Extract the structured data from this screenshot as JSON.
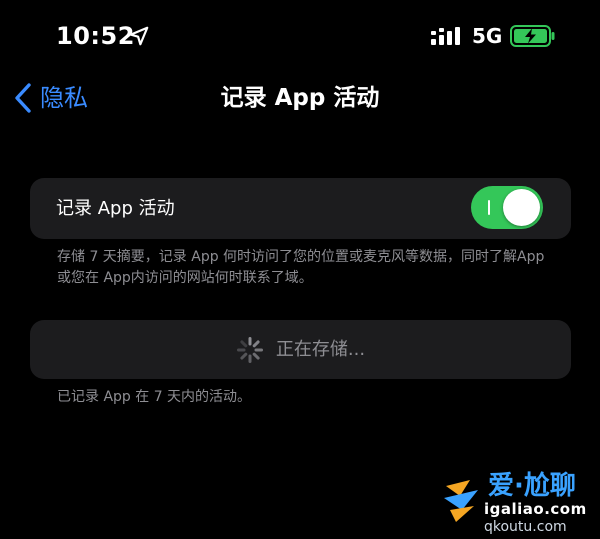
{
  "status_bar": {
    "time": "10:52",
    "network": "5G",
    "icons": [
      "location-arrow-icon",
      "cellular-signal-icon",
      "battery-charging-icon"
    ]
  },
  "nav": {
    "back_label": "隐私",
    "title": "记录 App 活动"
  },
  "toggle_group": {
    "label": "记录 App 活动",
    "enabled": true
  },
  "footer_description": "存储 7 天摘要，记录 App 何时访问了您的位置或麦克风等数据，同时了解App或您在 App内访问的网站何时联系了域。",
  "saving_row": {
    "label": "正在存储..."
  },
  "footer_status": "已记录 App 在 7 天内的活动。",
  "watermark": {
    "title": "爱·尬聊",
    "domain": "igaliao.com",
    "domain_secondary": "qkoutu.com"
  },
  "colors": {
    "background": "#000000",
    "group_background": "#1c1c1e",
    "accent_blue": "#3a8bff",
    "toggle_on": "#34c759",
    "secondary_text": "#8e8e93",
    "battery_charging": "#34c759"
  }
}
